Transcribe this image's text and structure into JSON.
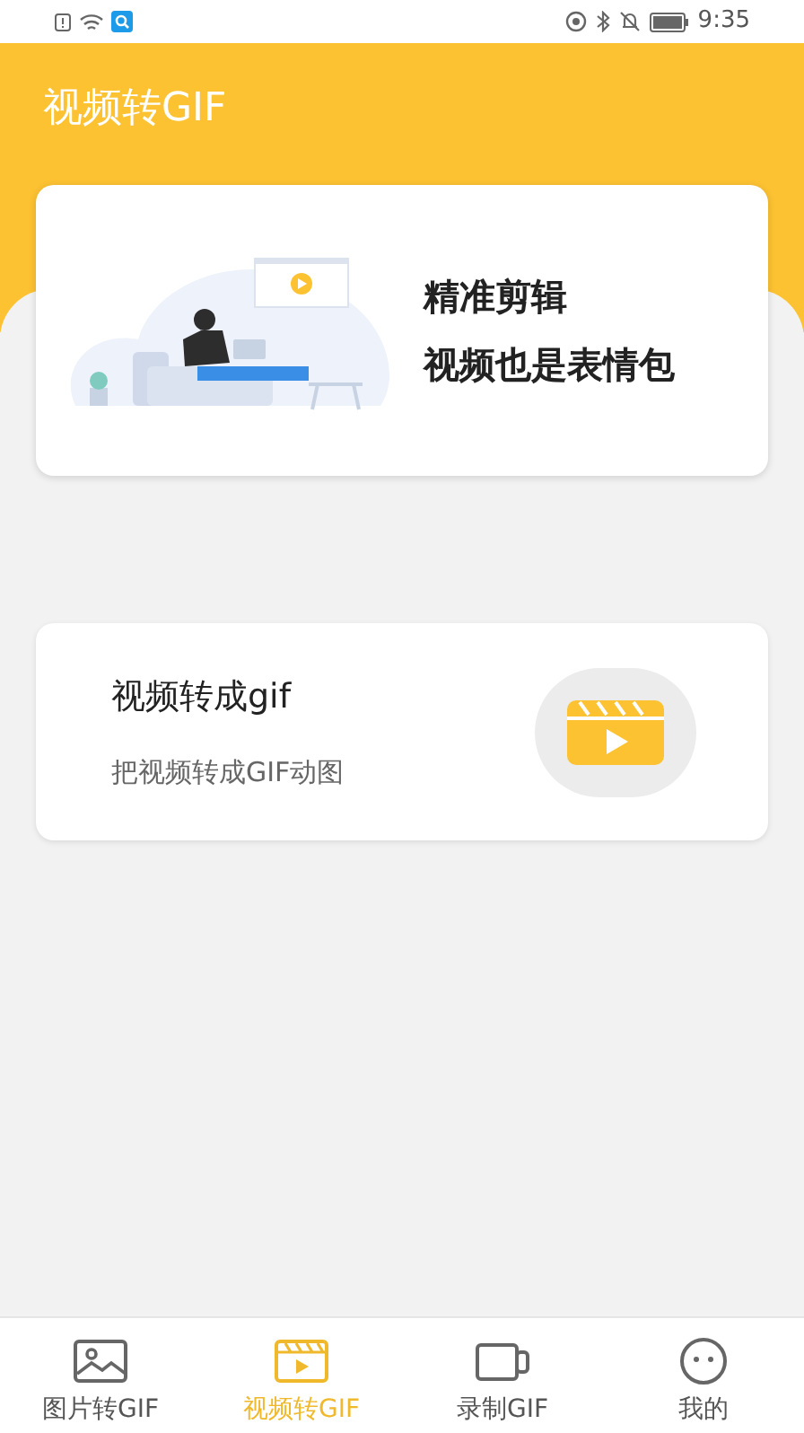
{
  "status_bar": {
    "time": "9:35"
  },
  "header": {
    "title": "视频转GIF"
  },
  "banner": {
    "lines": [
      "精准剪辑",
      "视频也是表情包"
    ]
  },
  "feature_card": {
    "title": "视频转成gif",
    "subtitle": "把视频转成GIF动图"
  },
  "tabs": [
    {
      "label": "图片转GIF",
      "kind": "image",
      "selected": false
    },
    {
      "label": "视频转GIF",
      "kind": "video",
      "selected": true
    },
    {
      "label": "录制GIF",
      "kind": "camera",
      "selected": false
    },
    {
      "label": "我的",
      "kind": "face",
      "selected": false
    }
  ]
}
